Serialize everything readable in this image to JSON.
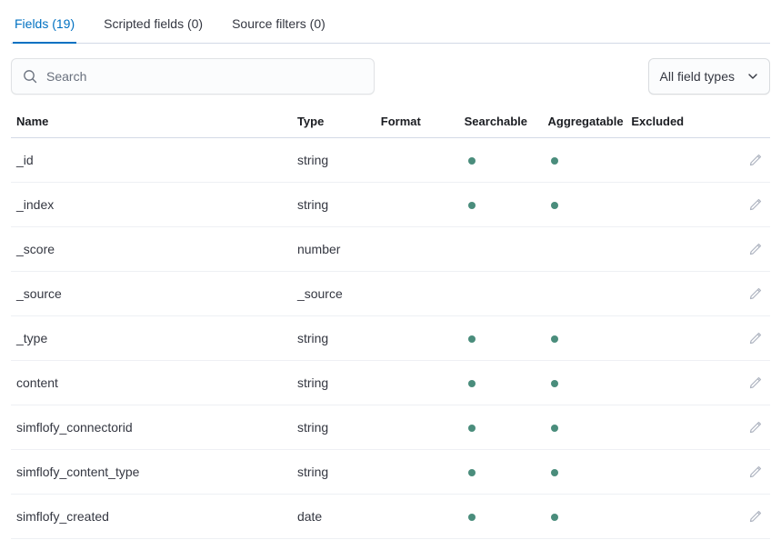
{
  "tabs": [
    {
      "label": "Fields (19)",
      "active": true
    },
    {
      "label": "Scripted fields (0)",
      "active": false
    },
    {
      "label": "Source filters (0)",
      "active": false
    }
  ],
  "search": {
    "placeholder": "Search"
  },
  "type_filter": {
    "label": "All field types"
  },
  "columns": {
    "name": "Name",
    "type": "Type",
    "format": "Format",
    "searchable": "Searchable",
    "aggregatable": "Aggregatable",
    "excluded": "Excluded"
  },
  "rows": [
    {
      "name": "_id",
      "type": "string",
      "format": "",
      "searchable": true,
      "aggregatable": true,
      "excluded": ""
    },
    {
      "name": "_index",
      "type": "string",
      "format": "",
      "searchable": true,
      "aggregatable": true,
      "excluded": ""
    },
    {
      "name": "_score",
      "type": "number",
      "format": "",
      "searchable": false,
      "aggregatable": false,
      "excluded": ""
    },
    {
      "name": "_source",
      "type": "_source",
      "format": "",
      "searchable": false,
      "aggregatable": false,
      "excluded": ""
    },
    {
      "name": "_type",
      "type": "string",
      "format": "",
      "searchable": true,
      "aggregatable": true,
      "excluded": ""
    },
    {
      "name": "content",
      "type": "string",
      "format": "",
      "searchable": true,
      "aggregatable": true,
      "excluded": ""
    },
    {
      "name": "simflofy_connectorid",
      "type": "string",
      "format": "",
      "searchable": true,
      "aggregatable": true,
      "excluded": ""
    },
    {
      "name": "simflofy_content_type",
      "type": "string",
      "format": "",
      "searchable": true,
      "aggregatable": true,
      "excluded": ""
    },
    {
      "name": "simflofy_created",
      "type": "date",
      "format": "",
      "searchable": true,
      "aggregatable": true,
      "excluded": ""
    }
  ]
}
